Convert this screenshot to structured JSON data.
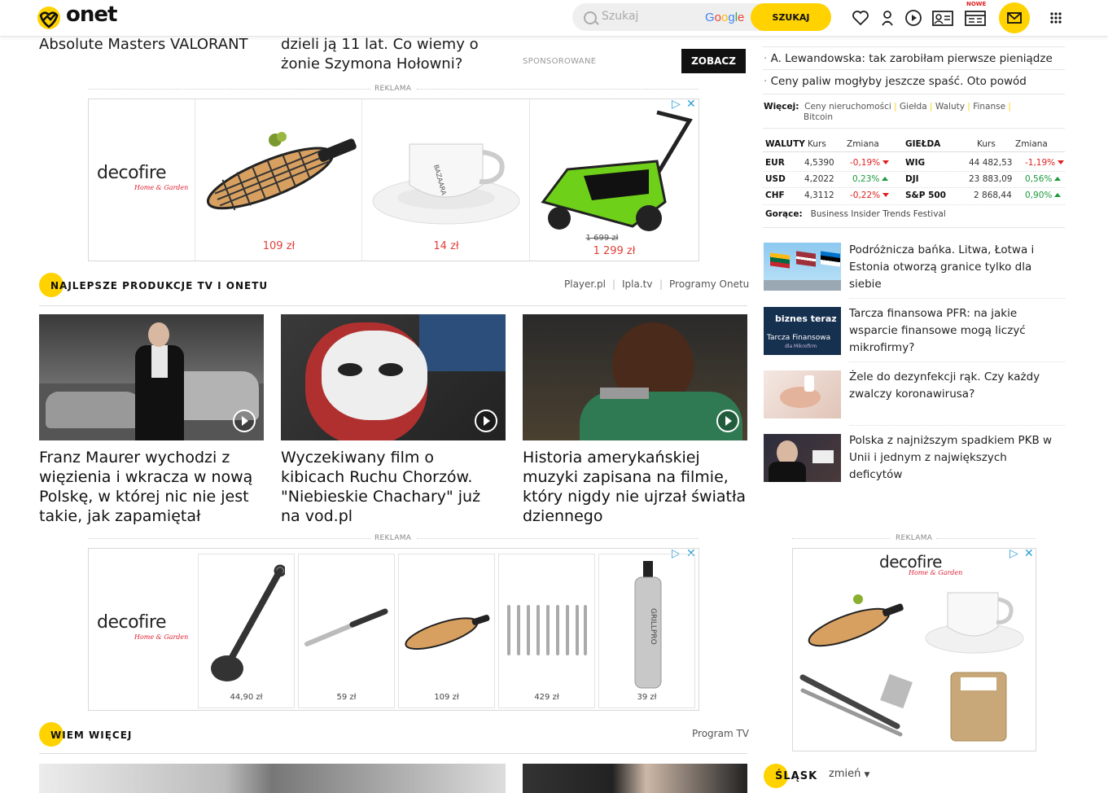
{
  "header": {
    "logo_text": "onet",
    "search_placeholder": "Szukaj",
    "google_label": "Google",
    "search_button": "SZUKAJ",
    "new_badge": "NOWE"
  },
  "top_stories": {
    "left_title": "Absolute Masters VALORANT",
    "middle_title": "dzieli ją 11 lat. Co wiemy o żonie Szymona Hołowni?",
    "sponsored_label": "SPONSOROWANE",
    "cta_button": "ZOBACZ"
  },
  "ads": {
    "reklama_label": "REKLAMA",
    "brand": "decofire",
    "brand_sub": "Home & Garden",
    "top_prices": [
      "109 zł",
      "14 zł",
      "1 299 zł"
    ],
    "top_old_price": "1 699 zł",
    "bottom_prices": [
      "44,90 zł",
      "59 zł",
      "109 zł",
      "429 zł",
      "39 zł"
    ]
  },
  "section_tv": {
    "title": "NAJLEPSZE PRODUKCJE TV I ONETU",
    "links": [
      "Player.pl",
      "Ipla.tv",
      "Programy Onetu"
    ],
    "cards": [
      {
        "title": "Franz Maurer wychodzi z więzienia i wkracza w nową Polskę, w której nic nie jest takie, jak zapamiętał"
      },
      {
        "title": "Wyczekiwany film o kibicach Ruchu Chorzów. \"Niebieskie Chachary\" już na vod.pl"
      },
      {
        "title": "Historia amerykańskiej muzyki zapisana na filmie, który nigdy nie ujrzał światła dziennego"
      }
    ]
  },
  "section_wiem": {
    "title": "WIEM WIĘCEJ",
    "link": "Program TV"
  },
  "right": {
    "list": [
      "A. Lewandowska: tak zarobiłam pierwsze pieniądze",
      "Ceny paliw mogłyby jeszcze spaść. Oto powód"
    ],
    "wiecej_label": "Więcej:",
    "wiecej_links": [
      "Ceny nieruchomości",
      "Giełda",
      "Waluty",
      "Finanse",
      "Bitcoin"
    ],
    "waluty_headers": [
      "WALUTY",
      "Kurs",
      "Zmiana"
    ],
    "gielda_headers": [
      "GIEŁDA",
      "Kurs",
      "Zmiana"
    ],
    "waluty": [
      {
        "name": "EUR",
        "kurs": "4,5390",
        "zmiana": "-0,19%",
        "dir": "down"
      },
      {
        "name": "USD",
        "kurs": "4,2022",
        "zmiana": "0,23%",
        "dir": "up"
      },
      {
        "name": "CHF",
        "kurs": "4,3112",
        "zmiana": "-0,22%",
        "dir": "down"
      }
    ],
    "gielda": [
      {
        "name": "WIG",
        "kurs": "44 482,53",
        "zmiana": "-1,19%",
        "dir": "down"
      },
      {
        "name": "DJI",
        "kurs": "23 883,09",
        "zmiana": "0,56%",
        "dir": "up"
      },
      {
        "name": "S&P 500",
        "kurs": "2 868,44",
        "zmiana": "0,90%",
        "dir": "up"
      }
    ],
    "gorace_label": "Gorące:",
    "gorace_link": "Business Insider Trends Festival",
    "news": [
      {
        "title": "Podróżnicza bańka. Litwa, Łotwa i Estonia otworzą granice tylko dla siebie"
      },
      {
        "title": "Tarcza finansowa PFR: na jakie wsparcie finansowe mogą liczyć mikrofirmy?",
        "thumb_text": "biznes teraz",
        "thumb_sub": "Tarcza Finansowa",
        "thumb_sub2": "dla Mikrofirm"
      },
      {
        "title": "Żele do dezynfekcji rąk. Czy każdy zwalczy koronawirusa?"
      },
      {
        "title": "Polska z najniższym spadkiem PKB w Unii i jednym z największych deficytów"
      }
    ],
    "region_title": "ŚLĄSK",
    "region_change": "zmień"
  },
  "colors": {
    "accent": "#ffd200",
    "down": "#e02020",
    "up": "#1a9a3a",
    "price": "#e0403a"
  }
}
